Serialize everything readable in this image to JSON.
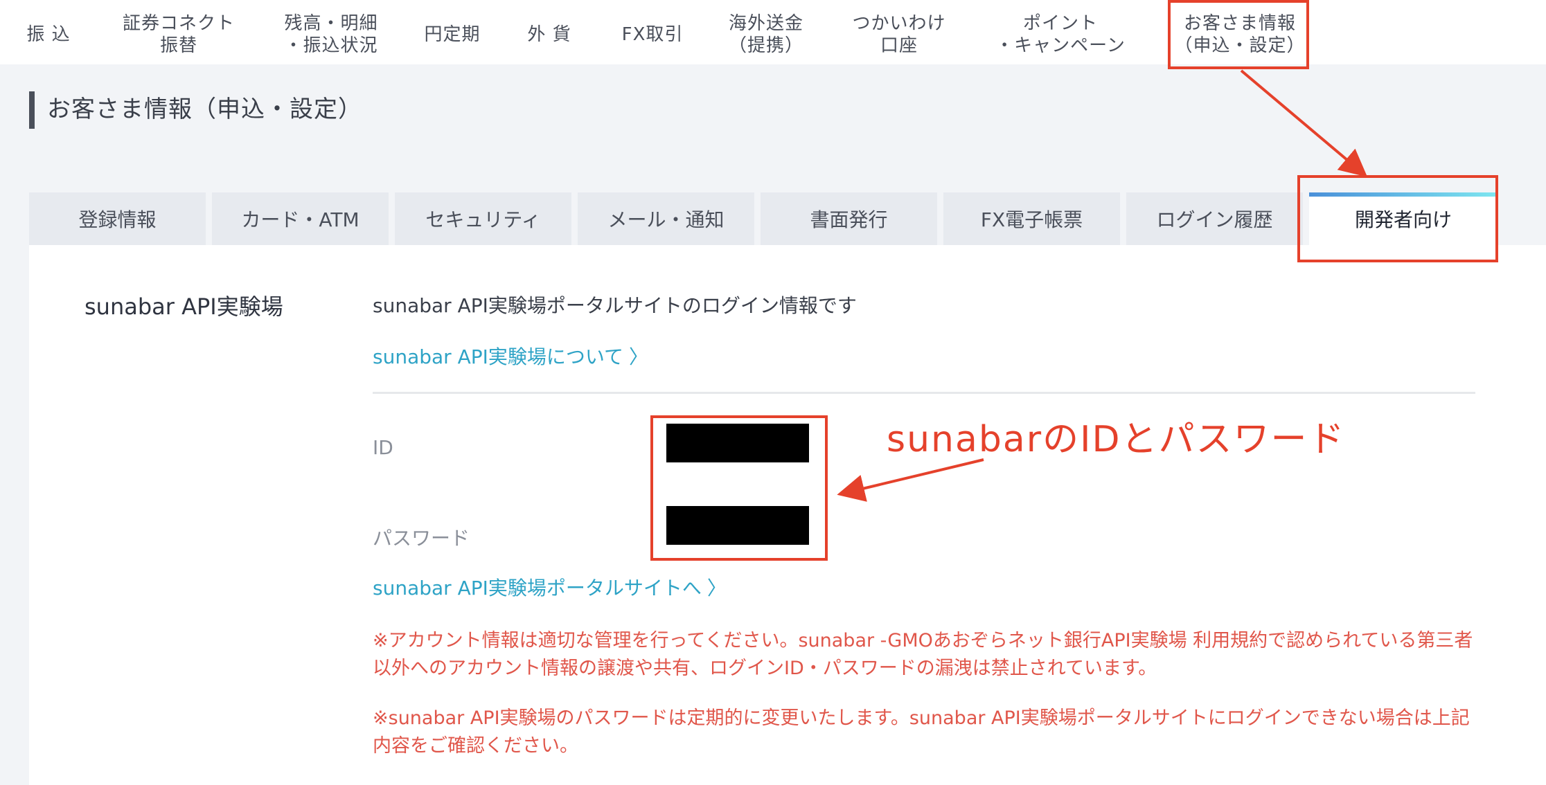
{
  "top_nav": [
    {
      "label": "振 込"
    },
    {
      "label": "証券コネクト\n振替"
    },
    {
      "label": "残高・明細\n・振込状況"
    },
    {
      "label": "円定期"
    },
    {
      "label": "外 貨"
    },
    {
      "label": "FX取引"
    },
    {
      "label": "海外送金\n（提携）"
    },
    {
      "label": "つかいわけ\n口座"
    },
    {
      "label": "ポイント\n・キャンペーン"
    },
    {
      "label": "お客さま情報\n（申込・設定）"
    }
  ],
  "page_title": "お客さま情報（申込・設定）",
  "tabs": [
    {
      "label": "登録情報"
    },
    {
      "label": "カード・ATM"
    },
    {
      "label": "セキュリティ"
    },
    {
      "label": "メール・通知"
    },
    {
      "label": "書面発行"
    },
    {
      "label": "FX電子帳票"
    },
    {
      "label": "ログイン履歴"
    },
    {
      "label": "開発者向け",
      "active": true
    }
  ],
  "section": {
    "title": "sunabar API実験場",
    "description": "sunabar API実験場ポータルサイトのログイン情報です",
    "about_link": "sunabar API実験場について",
    "id_label": "ID",
    "password_label": "パスワード",
    "portal_link": "sunabar API実験場ポータルサイトへ",
    "note1": "※アカウント情報は適切な管理を行ってください。sunabar -GMOあおぞらネット銀行API実験場 利用規約で認められている第三者以外へのアカウント情報の譲渡や共有、ログインID・パスワードの漏洩は禁止されています。",
    "note2": "※sunabar API実験場のパスワードは定期的に変更いたします。sunabar API実験場ポータルサイトにログインできない場合は上記内容をご確認ください。"
  },
  "annotation": {
    "text": "sunabarのIDとパスワード",
    "color": "#e5412b"
  },
  "colors": {
    "link": "#2ea3c6",
    "note": "#e0564a",
    "tab_active_gradient": [
      "#4a90d9",
      "#7ee6f0"
    ]
  },
  "icons": {
    "chevron": "chevron-right-icon"
  }
}
